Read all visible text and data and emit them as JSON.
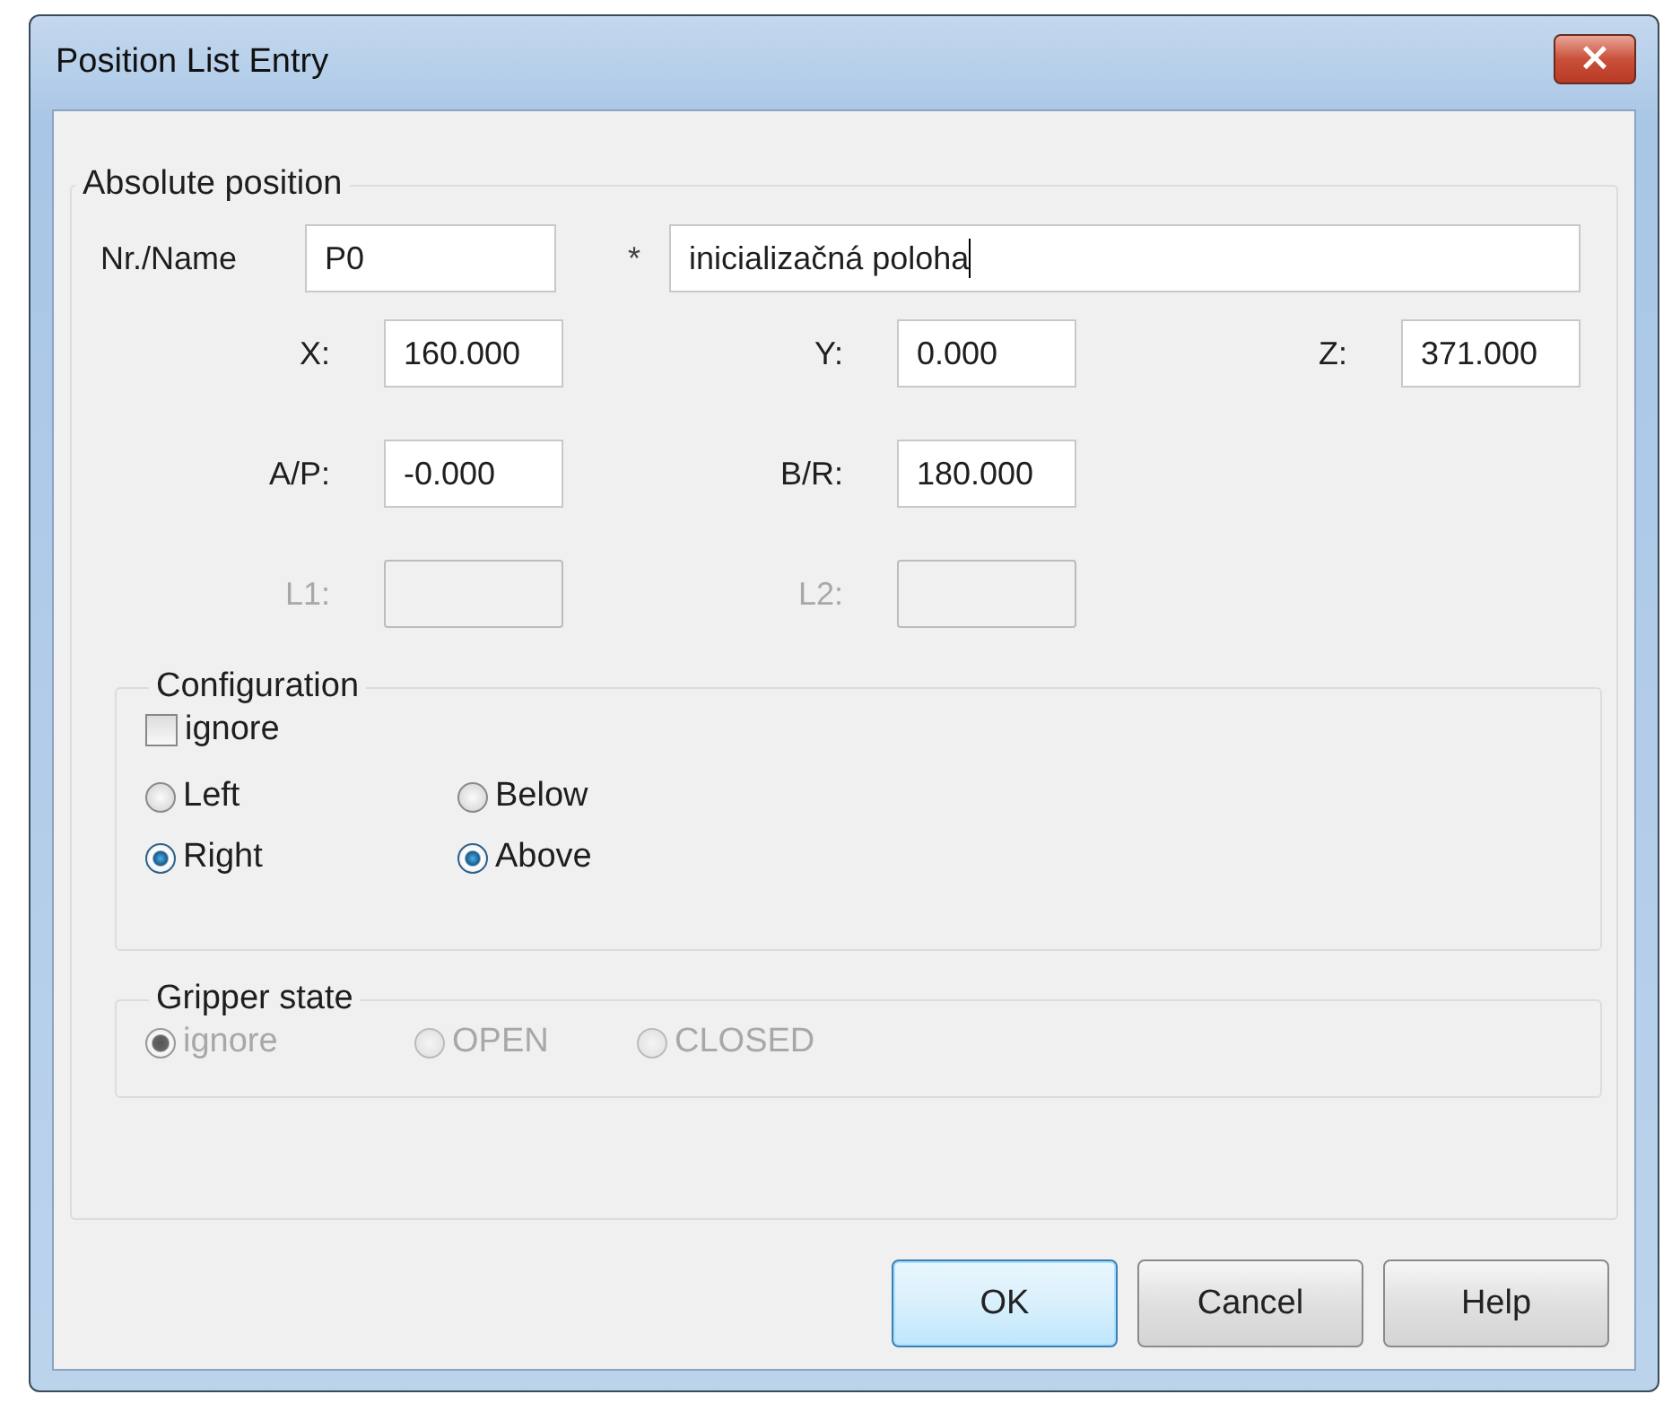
{
  "window": {
    "title": "Position List Entry",
    "close": "×"
  },
  "absolute_position": {
    "title": "Absolute position",
    "name_label": "Nr./Name",
    "name_value": "P0",
    "asterisk": "*",
    "description_value": "inicializačná poloha",
    "rows": [
      [
        {
          "label": "X:",
          "value": "160.000",
          "disabled": false
        },
        {
          "label": "Y:",
          "value": "0.000",
          "disabled": false
        },
        {
          "label": "Z:",
          "value": "371.000",
          "disabled": false
        }
      ],
      [
        {
          "label": "A/P:",
          "value": "-0.000",
          "disabled": false
        },
        {
          "label": "B/R:",
          "value": "180.000",
          "disabled": false
        }
      ],
      [
        {
          "label": "L1:",
          "disabled": true
        },
        {
          "label": "L2:",
          "disabled": true
        }
      ]
    ],
    "configuration": {
      "title": "Configuration",
      "ignore": {
        "label": "ignore",
        "checked": false
      },
      "radio_rows": [
        [
          {
            "label": "Left",
            "selected": false
          },
          {
            "label": "Below",
            "selected": false
          }
        ],
        [
          {
            "label": "Right",
            "selected": true
          },
          {
            "label": "Above",
            "selected": true
          }
        ]
      ]
    },
    "gripper_state": {
      "title": "Gripper state",
      "disabled": true,
      "options": [
        {
          "label": "ignore",
          "selected": true
        },
        {
          "label": "OPEN",
          "selected": false
        },
        {
          "label": "CLOSED",
          "selected": false
        }
      ]
    }
  },
  "buttons": [
    {
      "label": "OK",
      "focused": true
    },
    {
      "label": "Cancel",
      "focused": false
    },
    {
      "label": "Help",
      "focused": false
    }
  ]
}
